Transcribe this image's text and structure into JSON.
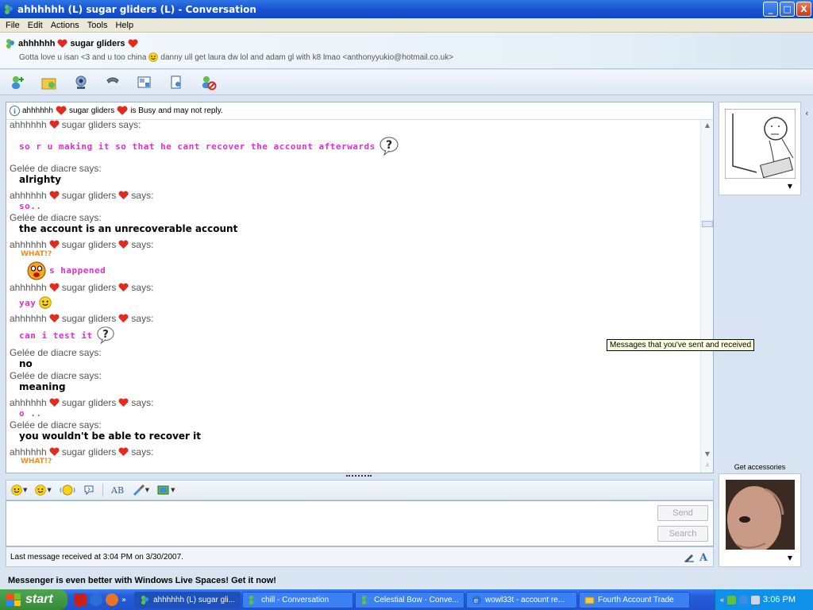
{
  "window": {
    "title": "ahhhhhh (L) sugar gliders (L) - Conversation",
    "buttons": [
      "_",
      "□",
      "X"
    ]
  },
  "menu": [
    "File",
    "Edit",
    "Actions",
    "Tools",
    "Help"
  ],
  "contact": {
    "name_part1": "ahhhhhh",
    "name_part2": "sugar gliders",
    "personal_message_1": "Gotta love u isan <3 and u too china",
    "personal_message_2": "danny ull get laura dw lol and adam gl with k8 lmao <anthonyyukio@hotmail.co.uk>"
  },
  "toolbar_icons": [
    "invite-icon",
    "send-files-icon",
    "video-call-icon",
    "call-icon",
    "activities-icon",
    "games-icon",
    "block-icon"
  ],
  "busy_notice": {
    "name_part1": "ahhhhhh",
    "name_part2": "sugar gliders",
    "status": "is Busy and may not reply."
  },
  "says": "says:",
  "sender_a": {
    "part1": "ahhhhhh",
    "part2": "sugar gliders"
  },
  "sender_b": "Gelée de diacre",
  "messages": [
    {
      "from": "a",
      "text": "so r u making it so that he cant recover the account afterwards"
    },
    {
      "from": "b",
      "text": "alrighty"
    },
    {
      "from": "a",
      "text": "so.."
    },
    {
      "from": "b",
      "text": "the account is an unrecoverable account"
    },
    {
      "from": "a",
      "what": "WHAT!?",
      "text": "s happened"
    },
    {
      "from": "a",
      "text": "yay"
    },
    {
      "from": "a",
      "text": "can i test it"
    },
    {
      "from": "b",
      "text": "no"
    },
    {
      "from": "b",
      "text": "meaning"
    },
    {
      "from": "a",
      "text": "o .."
    },
    {
      "from": "b",
      "text": "you wouldn't be able to recover it"
    },
    {
      "from": "a",
      "what": "WHAT!?"
    }
  ],
  "tooltip": "Messages that you've sent and received",
  "input": {
    "send_label": "Send",
    "search_label": "Search"
  },
  "status_text": "Last message received at 3:04 PM on 3/30/2007.",
  "accessories_label": "Get accessories",
  "banner": "Messenger is even better with Windows Live Spaces! Get it now!",
  "taskbar": {
    "start_label": "start",
    "tasks": [
      "ahhhhhh (L) sugar gli...",
      "chill - Conversation",
      "Celestial Bow - Conve...",
      "wowl33t - account re...",
      "Fourth Account Trade"
    ],
    "clock": "3:06 PM"
  },
  "colors": {
    "pink_text": "#e02fd0",
    "what_orange": "#f08b1a",
    "titlebar_blue": "#0a46c6",
    "start_green": "#358a36"
  }
}
